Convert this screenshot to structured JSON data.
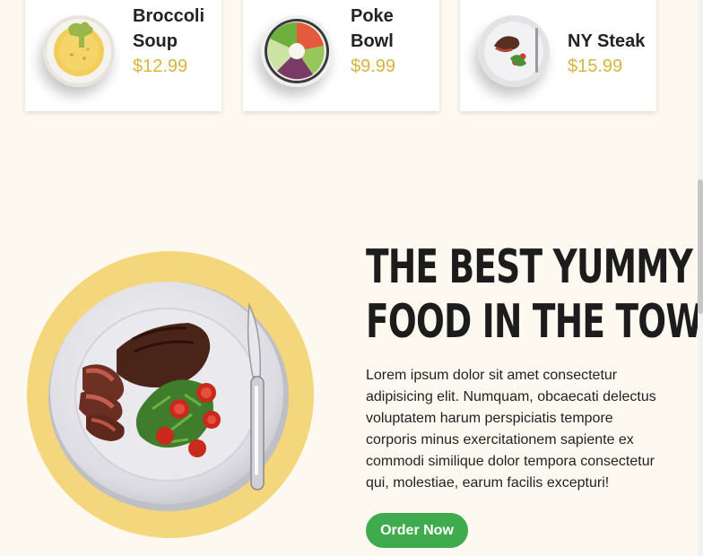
{
  "menu_cards": [
    {
      "name": "Broccoli Soup",
      "price": "$12.99",
      "image": "broccoli-soup"
    },
    {
      "name": "Poke Bowl",
      "price": "$9.99",
      "image": "poke-bowl"
    },
    {
      "name": "NY Steak",
      "price": "$15.99",
      "image": "ny-steak"
    }
  ],
  "hero": {
    "headline_line1": "THE BEST YUMMY",
    "headline_line2": "FOOD IN THE TOWN",
    "body": "Lorem ipsum dolor sit amet consectetur adipisicing elit. Numquam, obcaecati delectus voluptatem harum perspiciatis tempore corporis minus exercitationem sapiente ex commodi similique dolor tempora consectetur qui, molestiae, earum facilis excepturi!",
    "button_label": "Order Now"
  },
  "colors": {
    "price": "#d9b53c",
    "plate_backdrop": "#f4d77c",
    "button": "#3faa4e",
    "background": "#fdf9f0"
  }
}
